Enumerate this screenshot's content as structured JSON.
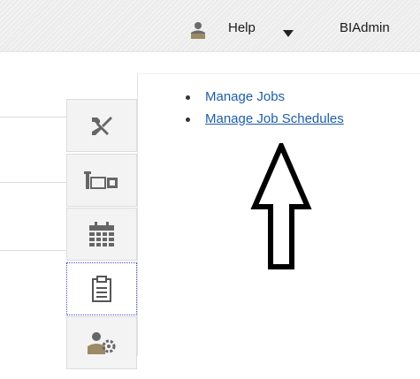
{
  "header": {
    "user_icon": "user-icon",
    "help_label": "Help",
    "help_caret_icon": "caret-down-icon",
    "user_label": "BIAdmin"
  },
  "tabs": [
    {
      "icon": "tools-icon"
    },
    {
      "icon": "layout-icon"
    },
    {
      "icon": "calendar-icon"
    },
    {
      "icon": "clipboard-icon",
      "selected": true
    },
    {
      "icon": "user-settings-icon"
    }
  ],
  "content": {
    "links": [
      {
        "label": "Manage Jobs"
      },
      {
        "label": "Manage Job Schedules"
      }
    ]
  },
  "annotation": {
    "icon": "arrow-up-icon"
  },
  "colors": {
    "link": "#1f5fa6",
    "header_bg": "#ececec",
    "selection_border": "#4a4ad0"
  }
}
